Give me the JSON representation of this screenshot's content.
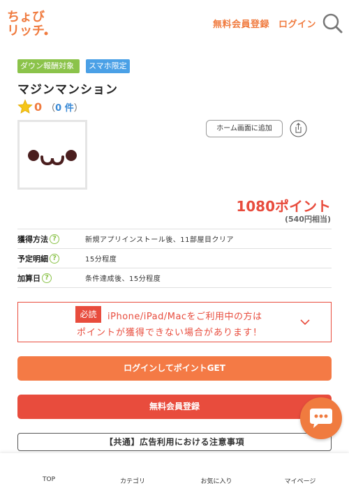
{
  "header": {
    "logo_text": "ちょびリッチ。",
    "register_label": "無料会員登録",
    "login_label": "ログイン"
  },
  "tags": {
    "download": "ダウン報酬対象",
    "smartphone": "スマホ限定"
  },
  "app": {
    "title": "マジンマンション",
    "rating_score": "0",
    "rating_count_open": "（",
    "rating_count": "0 件",
    "rating_count_close": "）"
  },
  "actions": {
    "add_home": "ホーム画面に追加"
  },
  "reward": {
    "points": "1080ポイント",
    "yen": "(540円相当)"
  },
  "info": [
    {
      "label": "獲得方法",
      "value": "新規アプリインストール後、11部屋目クリア"
    },
    {
      "label": "予定明細",
      "value": "15分程度"
    },
    {
      "label": "加算日",
      "value": "条件達成後、15分程度"
    }
  ],
  "warning": {
    "badge": "必読",
    "line1": "iPhone/iPad/Macをご利用中の方は",
    "line2": "ポイントが獲得できない場合があります！"
  },
  "buttons": {
    "login_get": "ログインしてポイントGET",
    "register": "無料会員登録",
    "notice": "【共通】広告利用における注意事項"
  },
  "bottom_nav": {
    "top": "TOP",
    "category": "カテゴリ",
    "favorite": "お気に入り",
    "mypage": "マイページ"
  },
  "colors": {
    "accent_orange": "#f07b3f",
    "accent_red": "#e84c3d",
    "tag_green": "#8bc34a",
    "tag_blue": "#4aa0e6"
  }
}
